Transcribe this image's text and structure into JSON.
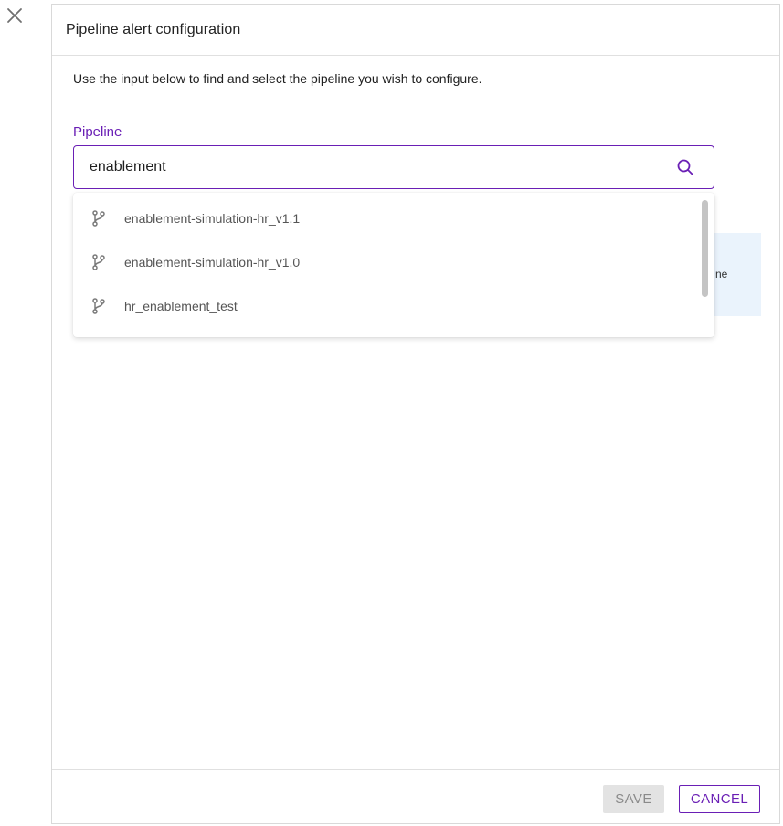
{
  "panel": {
    "title": "Pipeline alert configuration",
    "intro": "Use the input below to find and select the pipeline you wish to configure."
  },
  "pipeline_field": {
    "label": "Pipeline",
    "value": "enablement",
    "search_icon": "search-icon"
  },
  "dropdown": {
    "items": [
      {
        "label": "enablement-simulation-hr_v1.1",
        "icon": "branch-icon"
      },
      {
        "label": "enablement-simulation-hr_v1.0",
        "icon": "branch-icon"
      },
      {
        "label": "hr_enablement_test",
        "icon": "branch-icon"
      }
    ]
  },
  "info_box": {
    "partial_text": "ne"
  },
  "footer": {
    "save_label": "SAVE",
    "cancel_label": "CANCEL"
  },
  "close_icon": "close-icon",
  "colors": {
    "accent": "#6a1fb5",
    "info_bg": "#eaf3fc",
    "disabled_bg": "#e3e3e3",
    "disabled_text": "#8a8a8a"
  }
}
